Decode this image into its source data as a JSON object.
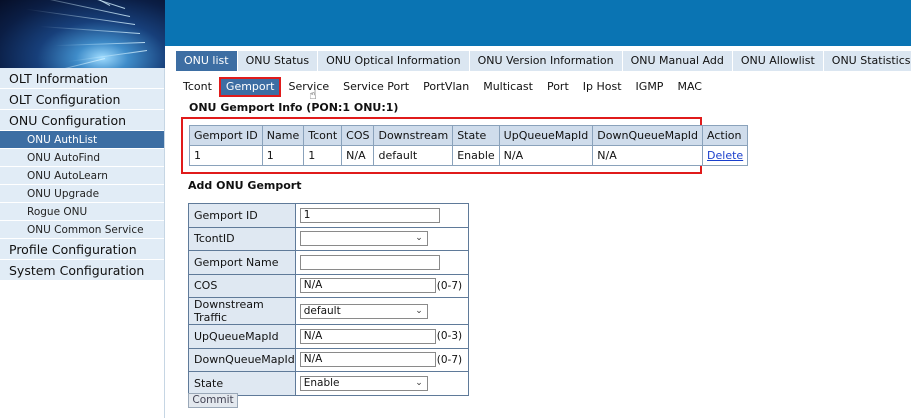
{
  "main_tabs": [
    {
      "label": "ONU list",
      "active": true
    },
    {
      "label": "ONU Status",
      "active": false
    },
    {
      "label": "ONU Optical Information",
      "active": false
    },
    {
      "label": "ONU Version Information",
      "active": false
    },
    {
      "label": "ONU Manual Add",
      "active": false
    },
    {
      "label": "ONU Allowlist",
      "active": false
    },
    {
      "label": "ONU Statistics",
      "active": false
    }
  ],
  "sub_tabs": [
    {
      "label": "Tcont",
      "active": false
    },
    {
      "label": "Gemport",
      "active": true
    },
    {
      "label": "Service",
      "active": false
    },
    {
      "label": "Service Port",
      "active": false
    },
    {
      "label": "PortVlan",
      "active": false
    },
    {
      "label": "Multicast",
      "active": false
    },
    {
      "label": "Port",
      "active": false
    },
    {
      "label": "Ip Host",
      "active": false
    },
    {
      "label": "IGMP",
      "active": false
    },
    {
      "label": "MAC",
      "active": false
    }
  ],
  "sidebar": {
    "items": [
      {
        "label": "OLT Information",
        "level": 1
      },
      {
        "label": "OLT Configuration",
        "level": 1
      },
      {
        "label": "ONU Configuration",
        "level": 1
      },
      {
        "label": "ONU AuthList",
        "level": 2,
        "active": true
      },
      {
        "label": "ONU AutoFind",
        "level": 2
      },
      {
        "label": "ONU AutoLearn",
        "level": 2
      },
      {
        "label": "ONU Upgrade",
        "level": 2
      },
      {
        "label": "Rogue ONU",
        "level": 2
      },
      {
        "label": "ONU Common Service",
        "level": 2
      },
      {
        "label": "Profile Configuration",
        "level": 1
      },
      {
        "label": "System Configuration",
        "level": 1
      }
    ]
  },
  "gemport_info": {
    "title": "ONU Gemport Info (PON:1 ONU:1)",
    "columns": [
      "Gemport ID",
      "Name",
      "Tcont",
      "COS",
      "Downstream",
      "State",
      "UpQueueMapId",
      "DownQueueMapId",
      "Action"
    ],
    "rows": [
      [
        "1",
        "1",
        "1",
        "N/A",
        "default",
        "Enable",
        "N/A",
        "N/A",
        "Delete"
      ]
    ]
  },
  "add_form": {
    "title": "Add ONU Gemport",
    "gemport_id": {
      "label": "Gemport ID",
      "value": "1"
    },
    "tcont_id": {
      "label": "TcontID",
      "value": ""
    },
    "gemport_name": {
      "label": "Gemport Name",
      "value": ""
    },
    "cos": {
      "label": "COS",
      "value": "N/A",
      "range": "(0-7)"
    },
    "downstream_traffic": {
      "label": "Downstream Traffic",
      "value": "default"
    },
    "up_queue_map_id": {
      "label": "UpQueueMapId",
      "value": "N/A",
      "range": "(0-3)"
    },
    "down_queue_map_id": {
      "label": "DownQueueMapId",
      "value": "N/A",
      "range": "(0-7)"
    },
    "state": {
      "label": "State",
      "value": "Enable"
    },
    "commit_label": "Commit"
  },
  "colors": {
    "topbar": "#0a74b3",
    "active_tab": "#3d6ea3",
    "highlight": "#e01b1b",
    "link": "#1a3fcc"
  }
}
